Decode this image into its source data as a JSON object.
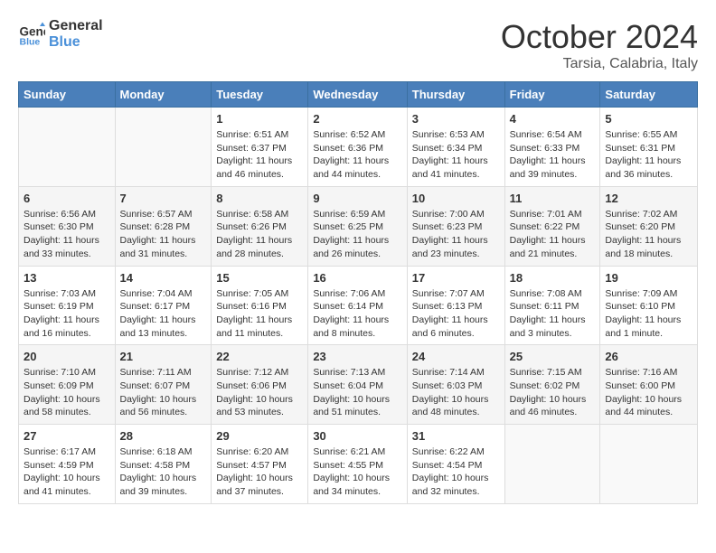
{
  "header": {
    "logo_general": "General",
    "logo_blue": "Blue",
    "month": "October 2024",
    "location": "Tarsia, Calabria, Italy"
  },
  "weekdays": [
    "Sunday",
    "Monday",
    "Tuesday",
    "Wednesday",
    "Thursday",
    "Friday",
    "Saturday"
  ],
  "rows": [
    [
      {
        "day": "",
        "info": ""
      },
      {
        "day": "",
        "info": ""
      },
      {
        "day": "1",
        "info": "Sunrise: 6:51 AM\nSunset: 6:37 PM\nDaylight: 11 hours and 46 minutes."
      },
      {
        "day": "2",
        "info": "Sunrise: 6:52 AM\nSunset: 6:36 PM\nDaylight: 11 hours and 44 minutes."
      },
      {
        "day": "3",
        "info": "Sunrise: 6:53 AM\nSunset: 6:34 PM\nDaylight: 11 hours and 41 minutes."
      },
      {
        "day": "4",
        "info": "Sunrise: 6:54 AM\nSunset: 6:33 PM\nDaylight: 11 hours and 39 minutes."
      },
      {
        "day": "5",
        "info": "Sunrise: 6:55 AM\nSunset: 6:31 PM\nDaylight: 11 hours and 36 minutes."
      }
    ],
    [
      {
        "day": "6",
        "info": "Sunrise: 6:56 AM\nSunset: 6:30 PM\nDaylight: 11 hours and 33 minutes."
      },
      {
        "day": "7",
        "info": "Sunrise: 6:57 AM\nSunset: 6:28 PM\nDaylight: 11 hours and 31 minutes."
      },
      {
        "day": "8",
        "info": "Sunrise: 6:58 AM\nSunset: 6:26 PM\nDaylight: 11 hours and 28 minutes."
      },
      {
        "day": "9",
        "info": "Sunrise: 6:59 AM\nSunset: 6:25 PM\nDaylight: 11 hours and 26 minutes."
      },
      {
        "day": "10",
        "info": "Sunrise: 7:00 AM\nSunset: 6:23 PM\nDaylight: 11 hours and 23 minutes."
      },
      {
        "day": "11",
        "info": "Sunrise: 7:01 AM\nSunset: 6:22 PM\nDaylight: 11 hours and 21 minutes."
      },
      {
        "day": "12",
        "info": "Sunrise: 7:02 AM\nSunset: 6:20 PM\nDaylight: 11 hours and 18 minutes."
      }
    ],
    [
      {
        "day": "13",
        "info": "Sunrise: 7:03 AM\nSunset: 6:19 PM\nDaylight: 11 hours and 16 minutes."
      },
      {
        "day": "14",
        "info": "Sunrise: 7:04 AM\nSunset: 6:17 PM\nDaylight: 11 hours and 13 minutes."
      },
      {
        "day": "15",
        "info": "Sunrise: 7:05 AM\nSunset: 6:16 PM\nDaylight: 11 hours and 11 minutes."
      },
      {
        "day": "16",
        "info": "Sunrise: 7:06 AM\nSunset: 6:14 PM\nDaylight: 11 hours and 8 minutes."
      },
      {
        "day": "17",
        "info": "Sunrise: 7:07 AM\nSunset: 6:13 PM\nDaylight: 11 hours and 6 minutes."
      },
      {
        "day": "18",
        "info": "Sunrise: 7:08 AM\nSunset: 6:11 PM\nDaylight: 11 hours and 3 minutes."
      },
      {
        "day": "19",
        "info": "Sunrise: 7:09 AM\nSunset: 6:10 PM\nDaylight: 11 hours and 1 minute."
      }
    ],
    [
      {
        "day": "20",
        "info": "Sunrise: 7:10 AM\nSunset: 6:09 PM\nDaylight: 10 hours and 58 minutes."
      },
      {
        "day": "21",
        "info": "Sunrise: 7:11 AM\nSunset: 6:07 PM\nDaylight: 10 hours and 56 minutes."
      },
      {
        "day": "22",
        "info": "Sunrise: 7:12 AM\nSunset: 6:06 PM\nDaylight: 10 hours and 53 minutes."
      },
      {
        "day": "23",
        "info": "Sunrise: 7:13 AM\nSunset: 6:04 PM\nDaylight: 10 hours and 51 minutes."
      },
      {
        "day": "24",
        "info": "Sunrise: 7:14 AM\nSunset: 6:03 PM\nDaylight: 10 hours and 48 minutes."
      },
      {
        "day": "25",
        "info": "Sunrise: 7:15 AM\nSunset: 6:02 PM\nDaylight: 10 hours and 46 minutes."
      },
      {
        "day": "26",
        "info": "Sunrise: 7:16 AM\nSunset: 6:00 PM\nDaylight: 10 hours and 44 minutes."
      }
    ],
    [
      {
        "day": "27",
        "info": "Sunrise: 6:17 AM\nSunset: 4:59 PM\nDaylight: 10 hours and 41 minutes."
      },
      {
        "day": "28",
        "info": "Sunrise: 6:18 AM\nSunset: 4:58 PM\nDaylight: 10 hours and 39 minutes."
      },
      {
        "day": "29",
        "info": "Sunrise: 6:20 AM\nSunset: 4:57 PM\nDaylight: 10 hours and 37 minutes."
      },
      {
        "day": "30",
        "info": "Sunrise: 6:21 AM\nSunset: 4:55 PM\nDaylight: 10 hours and 34 minutes."
      },
      {
        "day": "31",
        "info": "Sunrise: 6:22 AM\nSunset: 4:54 PM\nDaylight: 10 hours and 32 minutes."
      },
      {
        "day": "",
        "info": ""
      },
      {
        "day": "",
        "info": ""
      }
    ]
  ]
}
